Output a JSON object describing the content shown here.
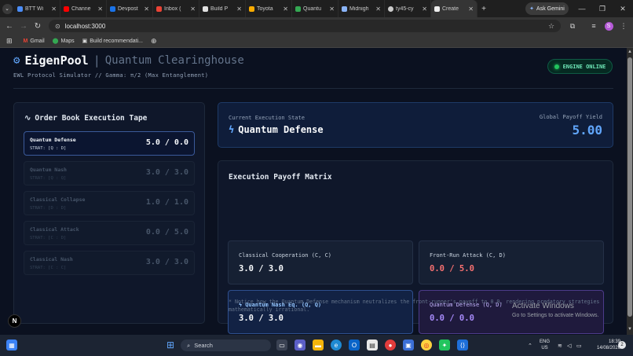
{
  "browser": {
    "tabs": [
      {
        "label": "BTT Wi",
        "color": "#4b8df8"
      },
      {
        "label": "Channe",
        "color": "#ff0000"
      },
      {
        "label": "Devpost",
        "color": "#1a73e8"
      },
      {
        "label": "Inbox (",
        "color": "#ea4335"
      },
      {
        "label": "Build P",
        "color": "#e0e0e0"
      },
      {
        "label": "Toyota",
        "color": "#f9ab00"
      },
      {
        "label": "Quantu",
        "color": "#34a853"
      },
      {
        "label": "Midnigh",
        "color": "#8ab4f8"
      },
      {
        "label": "ty45-cy",
        "color": "#cccccc"
      },
      {
        "label": "Create",
        "color": "#eeeeee"
      }
    ],
    "ask_gemini": "Ask Gemini",
    "url": "localhost:3000",
    "bookmarks": [
      "Gmail",
      "Maps",
      "Build recommendati..."
    ],
    "profile_initial": "S"
  },
  "header": {
    "brand": "EigenPool",
    "separator": "|",
    "subtitle": "Quantum Clearinghouse",
    "protocol_line": "EWL Protocol Simulator // Gamma: π/2 (Max Entanglement)",
    "status": "ENGINE ONLINE"
  },
  "tape": {
    "title": "Order Book Execution Tape",
    "rows": [
      {
        "name": "Quantum Defense",
        "strategy": "STRAT: [Q : D]",
        "payoff": "5.0 / 0.0",
        "active": true
      },
      {
        "name": "Quantum Nash",
        "strategy": "STRAT: [Q : Q]",
        "payoff": "3.0 / 3.0",
        "active": false
      },
      {
        "name": "Classical Collapse",
        "strategy": "STRAT: [D : D]",
        "payoff": "1.0 / 1.0",
        "active": false
      },
      {
        "name": "Classical Attack",
        "strategy": "STRAT: [C : D]",
        "payoff": "0.0 / 5.0",
        "active": false
      },
      {
        "name": "Classical Nash",
        "strategy": "STRAT: [C : C]",
        "payoff": "3.0 / 3.0",
        "active": false
      }
    ]
  },
  "state": {
    "label": "Current Execution State",
    "value": "Quantum Defense",
    "yield_label": "Global Payoff Yield",
    "yield_value": "5.00"
  },
  "matrix": {
    "title": "Execution Payoff Matrix",
    "cells": [
      {
        "label": "Classical Cooperation (C, C)",
        "value": "3.0 / 3.0"
      },
      {
        "label": "Front-Run Attack (C, D)",
        "value": "0.0 / 5.0"
      },
      {
        "label": "Quantum Nash Eq. (Q, Q)",
        "value": "3.0 / 3.0"
      },
      {
        "label": "Quantum Defense (Q, D)",
        "value": "0.0 / 0.0"
      }
    ],
    "note": "* Notice how the Quantum Defense mechanism neutralizes the front-runner's payoff to 0.0, rendering predatory strategies mathematically irrational."
  },
  "watermark": {
    "title": "Activate Windows",
    "subtitle": "Go to Settings to activate Windows."
  },
  "taskbar": {
    "search": "Search",
    "lang_top": "ENG",
    "lang_bottom": "US",
    "time": "18:39",
    "date": "14/08/2026",
    "notifications": "2"
  }
}
